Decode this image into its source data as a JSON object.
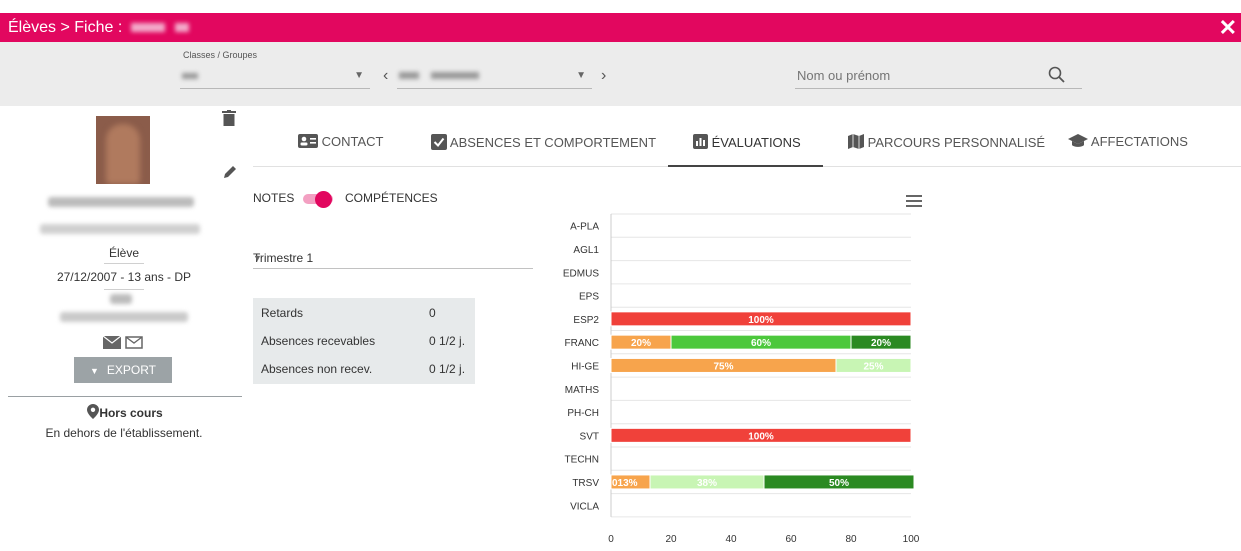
{
  "header": {
    "breadcrumb": "Élèves > Fiche :",
    "close_label": "✕"
  },
  "filters": {
    "classes_label": "Classes / Groupes",
    "prev_arrow": "‹",
    "next_arrow": "›",
    "search_placeholder": "Nom ou prénom"
  },
  "student": {
    "role": "Élève",
    "birth_info": "27/12/2007 - 13 ans - DP",
    "export_label": "EXPORT",
    "location_title": "Hors cours",
    "location_detail": "En dehors de l'établissement."
  },
  "tabs": [
    {
      "label": "CONTACT",
      "icon": "contact-card-icon"
    },
    {
      "label": "ABSENCES ET COMPORTEMENT",
      "icon": "checkbox-icon"
    },
    {
      "label": "ÉVALUATIONS",
      "icon": "bar-chart-icon",
      "active": true
    },
    {
      "label": "PARCOURS PERSONNALISÉ",
      "icon": "map-icon"
    },
    {
      "label": "AFFECTATIONS",
      "icon": "graduation-cap-icon"
    }
  ],
  "toggle": {
    "left_label": "NOTES",
    "right_label": "COMPÉTENCES",
    "selected": "COMPÉTENCES"
  },
  "period": {
    "selected": "Trimestre 1"
  },
  "stats": [
    {
      "label": "Retards",
      "value": "0"
    },
    {
      "label": "Absences recevables",
      "value": "0 1/2 j."
    },
    {
      "label": "Absences non recev.",
      "value": "0 1/2 j."
    }
  ],
  "colors": {
    "brand": "#e2075f",
    "red": "#f0413a",
    "orange": "#f7a44c",
    "light_green": "#c8f5b4",
    "green": "#4cc83c",
    "dark_green": "#2b8a22"
  },
  "chart_data": {
    "type": "bar",
    "orientation": "horizontal",
    "stacked": true,
    "categories": [
      "A-PLA",
      "AGL1",
      "EDMUS",
      "EPS",
      "ESP2",
      "FRANC",
      "HI-GE",
      "MATHS",
      "PH-CH",
      "SVT",
      "TECHN",
      "TRSV",
      "VICLA"
    ],
    "series": [
      {
        "color": "#f0413a",
        "values": [
          0,
          0,
          0,
          0,
          100,
          0,
          0,
          0,
          0,
          100,
          0,
          0,
          0
        ]
      },
      {
        "color": "#f7a44c",
        "values": [
          0,
          0,
          0,
          0,
          0,
          20,
          75,
          0,
          0,
          0,
          0,
          13,
          0
        ]
      },
      {
        "color": "#c8f5b4",
        "values": [
          0,
          0,
          0,
          0,
          0,
          0,
          25,
          0,
          0,
          0,
          0,
          38,
          0
        ]
      },
      {
        "color": "#4cc83c",
        "values": [
          0,
          0,
          0,
          0,
          0,
          60,
          0,
          0,
          0,
          0,
          0,
          0,
          0
        ]
      },
      {
        "color": "#2b8a22",
        "values": [
          0,
          0,
          0,
          0,
          0,
          20,
          0,
          0,
          0,
          0,
          0,
          50,
          0
        ]
      }
    ],
    "data_labels": {
      "ESP2": [
        "100%"
      ],
      "FRANC": [
        "20%",
        "60%",
        "20%"
      ],
      "HI-GE": [
        "75%",
        "25%"
      ],
      "SVT": [
        "100%"
      ],
      "TRSV": [
        "013%",
        "38%",
        "50%"
      ]
    },
    "xlim": [
      0,
      100
    ],
    "xticks": [
      0,
      20,
      40,
      60,
      80,
      100
    ],
    "grid": true,
    "legend": "none"
  }
}
